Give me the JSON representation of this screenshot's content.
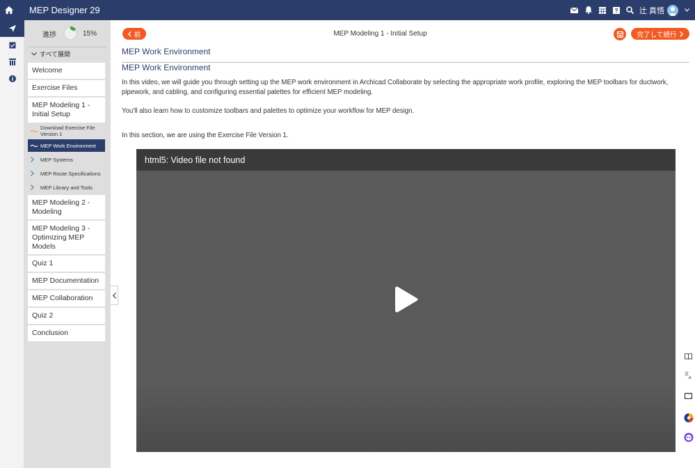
{
  "app": {
    "title": "MEP Designer 29",
    "user_name": "辻 真悟"
  },
  "sidebar": {
    "progress_label": "進捗",
    "progress_percent": "15%",
    "progress_value": 0.15,
    "expand_all": "すべて展開",
    "items": [
      {
        "label": "Welcome"
      },
      {
        "label": "Exercise Files"
      },
      {
        "label": "MEP Modeling 1 - Initial Setup"
      },
      {
        "label": "MEP Modeling 2 - Modeling"
      },
      {
        "label": "MEP Modeling 3 - Optimizing MEP Models"
      },
      {
        "label": "Quiz 1"
      },
      {
        "label": "MEP Documentation"
      },
      {
        "label": "MEP Collaboration"
      },
      {
        "label": "Quiz 2"
      },
      {
        "label": "Conclusion"
      }
    ],
    "subitems": [
      {
        "label": "Download Exercise File Version 1"
      },
      {
        "label": "MEP Work Environment"
      },
      {
        "label": "MEP Systems"
      },
      {
        "label": "MEP Route Specifications"
      },
      {
        "label": "MEP Library and Tools"
      }
    ]
  },
  "main": {
    "prev_label": "前",
    "next_label": "完了して続行",
    "lesson_title": "MEP Modeling 1 - Initial Setup",
    "page_title": "MEP Work Environment",
    "section_title": "MEP Work Environment",
    "paragraphs": [
      "In this video, we will guide you through setting up the MEP work environment in Archicad Collaborate by selecting the appropriate work profile, exploring the MEP toolbars for ductwork, pipework, and cabling, and configuring essential palettes for efficient MEP modeling.",
      "You'll also learn how to customize toolbars and palettes to optimize your workflow for MEP design.",
      "In this section, we are using the Exercise File Version 1."
    ],
    "video_error": "html5: Video file not found"
  },
  "colors": {
    "navy": "#2b3e6b",
    "accent": "#f15a22",
    "sidebar_bg": "#dedede"
  }
}
